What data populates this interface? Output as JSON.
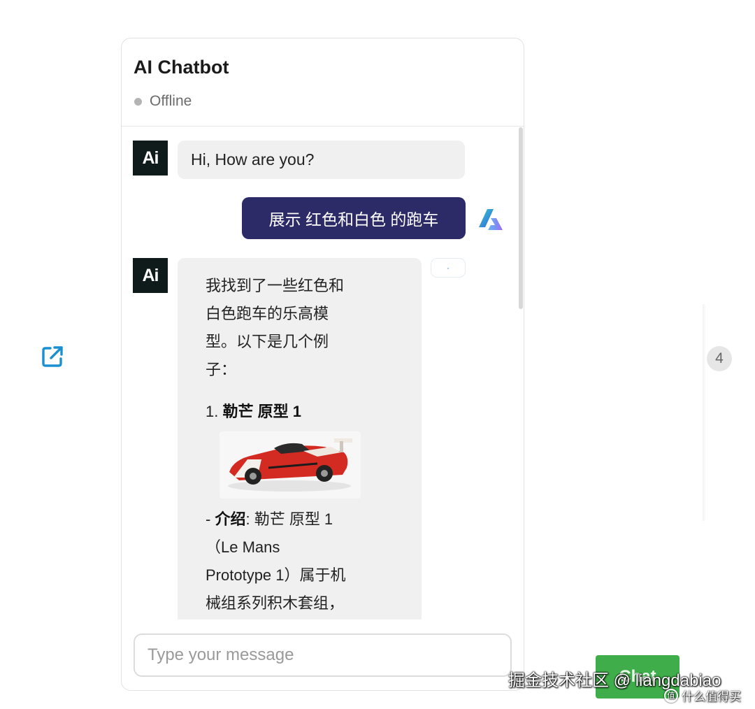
{
  "chat": {
    "title": "AI Chatbot",
    "status": "Offline",
    "bot_avatar_text": "Ai",
    "messages": [
      {
        "role": "bot",
        "text": "Hi, How are you?"
      },
      {
        "role": "user",
        "text": "展示 红色和白色 的跑车"
      }
    ],
    "reply": {
      "intro_lines": [
        "我找到了一些红色和",
        "白色跑车的乐高模",
        "型。以下是几个例",
        "子："
      ],
      "item_number": "1.",
      "item_title": "勒芒 原型 1",
      "desc_prefix": "- ",
      "desc_label": "介绍",
      "desc_colon": ": ",
      "desc_lines": [
        "勒芒 原型 1",
        "（Le Mans",
        "Prototype 1）属于机",
        "械组系列积木套组，"
      ]
    },
    "copy_badge": "·",
    "input_placeholder": "Type your message"
  },
  "side": {
    "page_number": "4",
    "chat_button_label": "Chat"
  },
  "watermark": {
    "main": "掘金技术社区 @ liangdabiao",
    "sub_icon": "值",
    "sub": "什么值得买"
  },
  "icons": {
    "external": "external-link-icon",
    "user_avatar": "user-logo-icon",
    "car": "lego-race-car-image"
  },
  "colors": {
    "user_bubble": "#2d2a68",
    "bot_bubble": "#f0f0f0",
    "bot_avatar": "#0f1a1a",
    "status_dot": "#b4b4b4",
    "chat_button": "#3fae4a",
    "external_icon": "#1a8fd1"
  }
}
